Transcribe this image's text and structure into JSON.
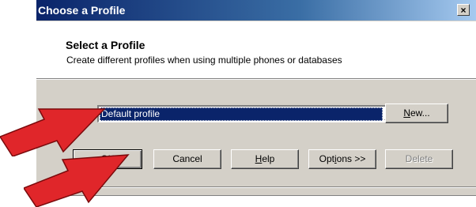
{
  "window": {
    "title": "Choose a Profile",
    "close_label": "×"
  },
  "header": {
    "title": "Select a Profile",
    "subtitle": "Create different profiles when using multiple phones or databases"
  },
  "profile_select": {
    "selected": "Default profile"
  },
  "buttons": {
    "new_pre": "N",
    "new_post": "ew...",
    "ok": "OK",
    "cancel": "Cancel",
    "help_pre": "H",
    "help_post": "elp",
    "options_pre": "Opt",
    "options_u": "i",
    "options_post": "ons >>",
    "delete": "Delete"
  },
  "colors": {
    "annotation_arrow": "#e0262a",
    "titlebar_start": "#0a246a",
    "dialog_face": "#d4d0c8"
  }
}
